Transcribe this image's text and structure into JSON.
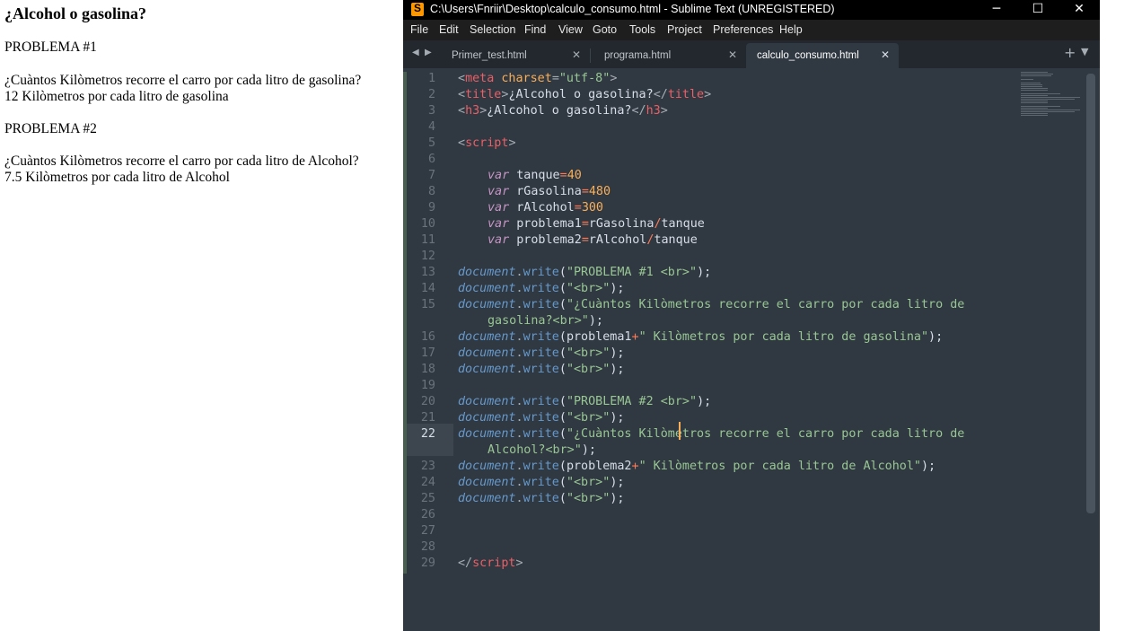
{
  "browser": {
    "heading": "¿Alcohol o gasolina?",
    "lines": [
      "PROBLEMA #1",
      "¿Cuàntos Kilòmetros recorre el carro por cada litro de gasolina?",
      "12 Kilòmetros por cada litro de gasolina",
      "PROBLEMA #2",
      "¿Cuàntos Kilòmetros recorre el carro por cada litro de Alcohol?",
      "7.5 Kilòmetros por cada litro de Alcohol"
    ]
  },
  "window": {
    "title": "C:\\Users\\Fnriir\\Desktop\\calculo_consumo.html - Sublime Text (UNREGISTERED)",
    "icons": {
      "app": "sublime-logo-icon",
      "minimize": "minimize-icon",
      "maximize": "maximize-icon",
      "close": "close-icon"
    }
  },
  "menu": [
    "File",
    "Edit",
    "Selection",
    "Find",
    "View",
    "Goto",
    "Tools",
    "Project",
    "Preferences",
    "Help"
  ],
  "tabs": [
    {
      "label": "Primer_test.html",
      "active": false
    },
    {
      "label": "programa.html",
      "active": false
    },
    {
      "label": "calculo_consumo.html",
      "active": true
    }
  ],
  "editor": {
    "current_line": 22,
    "line_numbers": [
      "1",
      "2",
      "3",
      "4",
      "5",
      "6",
      "7",
      "8",
      "9",
      "10",
      "11",
      "12",
      "13",
      "14",
      "15",
      "16",
      "17",
      "18",
      "19",
      "20",
      "21",
      "22",
      "23",
      "24",
      "25",
      "26",
      "27",
      "28",
      "29"
    ],
    "code": {
      "l1": {
        "open": "<",
        "tag": "meta",
        "attr": " charset",
        "eq": "=",
        "val": "\"utf-8\"",
        "close": ">"
      },
      "l2": {
        "o1": "<",
        "tag": "title",
        "c1": ">",
        "text": "¿Alcohol o gasolina?",
        "o2": "</",
        "tag2": "title",
        "c2": ">"
      },
      "l3": {
        "o1": "<",
        "tag": "h3",
        "c1": ">",
        "text": "¿Alcohol o gasolina?",
        "o2": "</",
        "tag2": "h3",
        "c2": ">"
      },
      "l5": {
        "o": "<",
        "tag": "script",
        "c": ">"
      },
      "vars": [
        {
          "kw": "var",
          "name": " tanque",
          "eq": "=",
          "val": "40"
        },
        {
          "kw": "var",
          "name": " rGasolina",
          "eq": "=",
          "val": "480"
        },
        {
          "kw": "var",
          "name": " rAlcohol",
          "eq": "=",
          "val": "300"
        },
        {
          "kw": "var",
          "name": " problema1",
          "eq": "=",
          "a": "rGasolina",
          "op": "/",
          "b": "tanque"
        },
        {
          "kw": "var",
          "name": " problema2",
          "eq": "=",
          "a": "rAlcohol",
          "op": "/",
          "b": "tanque"
        }
      ],
      "obj": "document",
      "dot": ".",
      "method": "write",
      "popen": "(",
      "pclose": ");",
      "plus": "+",
      "s13": "\"PROBLEMA #1 <br>\"",
      "sbr": "\"<br>\"",
      "s15a": "\"¿Cuàntos Kilòmetros recorre el carro por cada litro de",
      "s15b": "gasolina?<br>\"",
      "v16": "problema1",
      "s16": "\" Kilòmetros por cada litro de gasolina\"",
      "s20": "\"PROBLEMA #2 <br>\"",
      "s22a": "\"¿Cuàntos Kilòmetros recorre el carro por cada litro de",
      "s22b": "Alcohol?<br>\"",
      "v23": "problema2",
      "s23": "\" Kilòmetros por cada litro de Alcohol\"",
      "l29": {
        "o": "</",
        "tag": "script",
        "c": ">"
      }
    }
  },
  "colors": {
    "background": "#303841",
    "tag": "#ec5f66",
    "string": "#99c794",
    "keyword": "#c695c6",
    "number": "#f9ae58",
    "function": "#6699cc"
  }
}
